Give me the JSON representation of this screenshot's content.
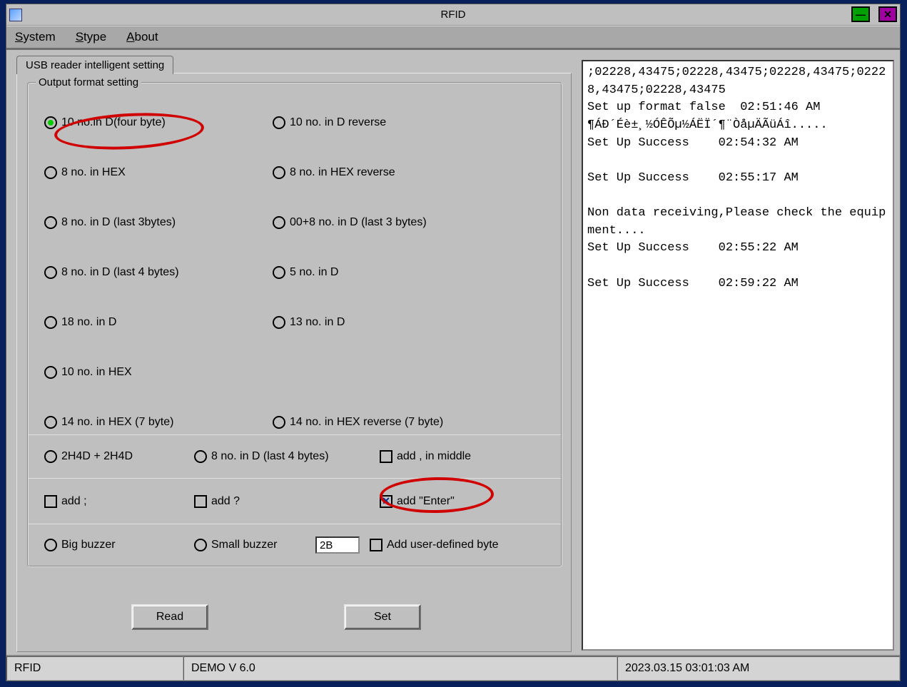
{
  "window": {
    "title": "RFID"
  },
  "menu": {
    "system": "System",
    "stype": "Stype",
    "about": "About"
  },
  "tab": {
    "label": "USB reader intelligent setting"
  },
  "group": {
    "title": "Output format setting"
  },
  "radios": {
    "r1a": "10 no.in D(four byte)",
    "r1b": "10 no. in D reverse",
    "r2a": "8 no. in HEX",
    "r2b": "8 no. in HEX reverse",
    "r3a": "8 no. in D (last 3bytes)",
    "r3b": "00+8 no. in D (last 3 bytes)",
    "r4a": "8 no. in D (last 4 bytes)",
    "r4b": "5 no. in D",
    "r5a": "18 no. in D",
    "r5b": "13 no. in D",
    "r6a": "10 no. in HEX",
    "r7a": "14 no. in HEX (7 byte)",
    "r7b": "14 no. in HEX reverse (7 byte)",
    "r8a": "2H4D + 2H4D",
    "r8b": "8 no. in D (last 4 bytes)",
    "c8c": "add , in middle",
    "c9a": "add ;",
    "c9b": "add ?",
    "c9c": "add \"Enter\"",
    "r10a": "Big buzzer",
    "r10b": "Small buzzer",
    "t10c": "2B",
    "c10c": "Add  user-defined byte"
  },
  "buttons": {
    "read": "Read",
    "set": "Set"
  },
  "log": ";02228,43475;02228,43475;02228,43475;02228,43475;02228,43475\nSet up format false  02:51:46 AM\n¶ÁÐ´Éè±¸½ÓÊÕµ½ÁËÏ´¶¨ÒåµÄÃüÁî.....\nSet Up Success    02:54:32 AM\n\nSet Up Success    02:55:17 AM\n\nNon data receiving,Please check the equipment....\nSet Up Success    02:55:22 AM\n\nSet Up Success    02:59:22 AM",
  "status": {
    "left": "RFID",
    "mid": "DEMO V 6.0",
    "right": "2023.03.15  03:01:03 AM"
  }
}
